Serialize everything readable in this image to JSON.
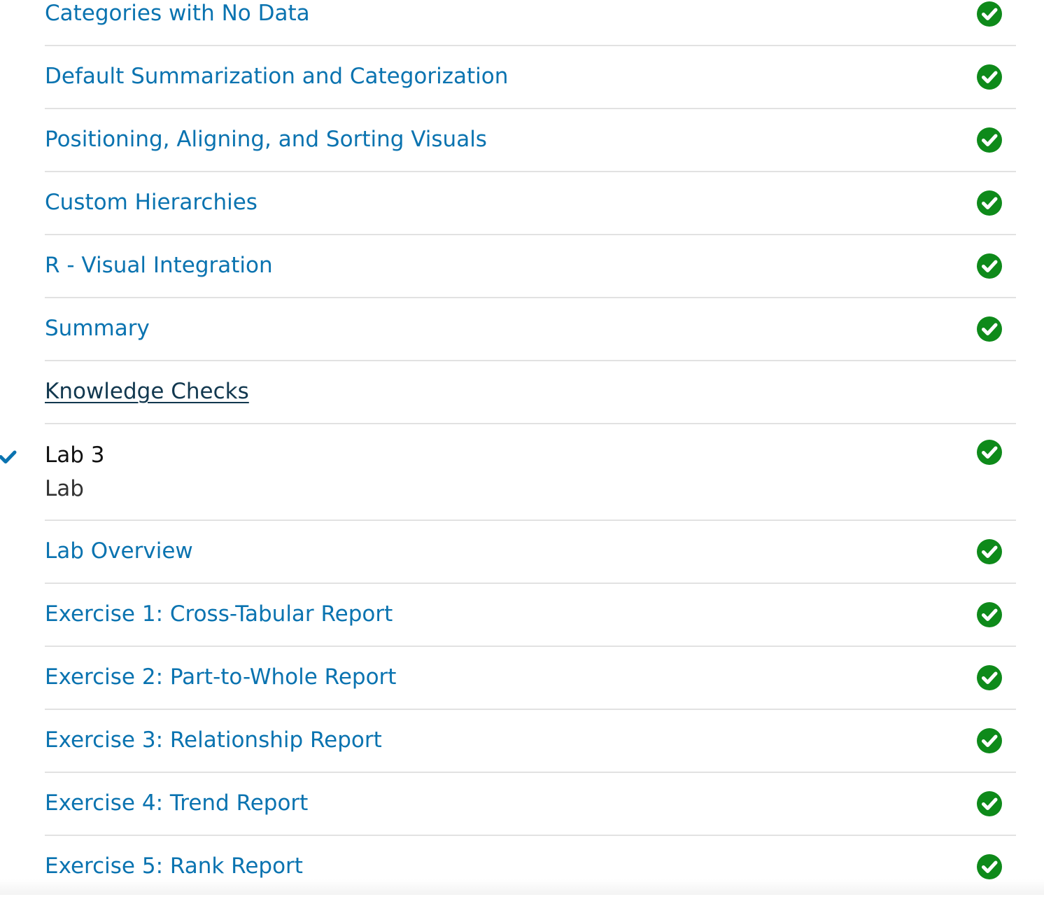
{
  "colors": {
    "link": "#0a73b0",
    "quiz_link": "#12384f",
    "complete_green": "#0e8a1a",
    "current_marker": "#0a73b0",
    "divider": "#e2e2e2"
  },
  "module_items_above": [
    {
      "label": "Categories with No Data",
      "status": "complete",
      "icon": "check-circle-icon"
    },
    {
      "label": "Default Summarization and Categorization",
      "status": "complete",
      "icon": "check-circle-icon"
    },
    {
      "label": "Positioning, Aligning, and Sorting Visuals",
      "status": "complete",
      "icon": "check-circle-icon"
    },
    {
      "label": "Custom Hierarchies",
      "status": "complete",
      "icon": "check-circle-icon"
    },
    {
      "label": "R - Visual Integration",
      "status": "complete",
      "icon": "check-circle-icon"
    },
    {
      "label": "Summary",
      "status": "complete",
      "icon": "check-circle-icon"
    },
    {
      "label": "Knowledge Checks",
      "status": "none",
      "icon": ""
    }
  ],
  "lab_module": {
    "title": "Lab 3",
    "subtitle": "Lab",
    "current_icon": "checkmark-icon",
    "status": "complete",
    "items": [
      {
        "label": "Lab Overview",
        "status": "complete",
        "icon": "check-circle-icon"
      },
      {
        "label": "Exercise 1: Cross-Tabular Report",
        "status": "complete",
        "icon": "check-circle-icon"
      },
      {
        "label": "Exercise 2: Part-to-Whole Report",
        "status": "complete",
        "icon": "check-circle-icon"
      },
      {
        "label": "Exercise 3: Relationship Report",
        "status": "complete",
        "icon": "check-circle-icon"
      },
      {
        "label": "Exercise 4: Trend Report",
        "status": "complete",
        "icon": "check-circle-icon"
      },
      {
        "label": "Exercise 5: Rank Report",
        "status": "complete",
        "icon": "check-circle-icon"
      }
    ]
  }
}
